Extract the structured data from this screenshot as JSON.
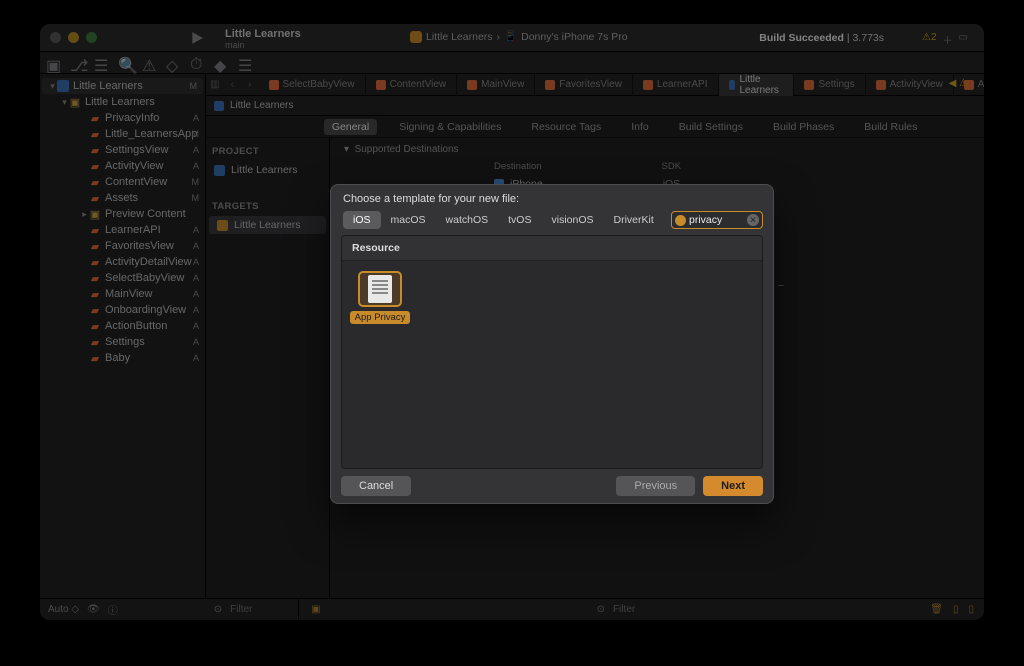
{
  "window": {
    "project_title": "Little Learners",
    "branch": "main",
    "scheme": "Little Learners",
    "scheme_sep": "›",
    "destination": "Donny's iPhone 7s Pro",
    "build_status_label": "Build Succeeded",
    "build_time": "3.773s",
    "warning_count": "2"
  },
  "navigator": {
    "root": "Little Learners",
    "root_badge": "M",
    "group": "Little Learners",
    "items": [
      {
        "name": "PrivacyInfo",
        "badge": "A"
      },
      {
        "name": "Little_LearnersApp",
        "badge": "M"
      },
      {
        "name": "SettingsView",
        "badge": "A"
      },
      {
        "name": "ActivityView",
        "badge": "A"
      },
      {
        "name": "ContentView",
        "badge": "M"
      },
      {
        "name": "Assets",
        "badge": "M"
      },
      {
        "name": "Preview Content",
        "badge": "",
        "folder": true
      },
      {
        "name": "LearnerAPI",
        "badge": "A"
      },
      {
        "name": "FavoritesView",
        "badge": "A"
      },
      {
        "name": "ActivityDetailView",
        "badge": "A"
      },
      {
        "name": "SelectBabyView",
        "badge": "A"
      },
      {
        "name": "MainView",
        "badge": "A"
      },
      {
        "name": "OnboardingView",
        "badge": "A"
      },
      {
        "name": "ActionButton",
        "badge": "A"
      },
      {
        "name": "Settings",
        "badge": "A"
      },
      {
        "name": "Baby",
        "badge": "A"
      }
    ],
    "filter_placeholder": "Filter"
  },
  "tabs": [
    {
      "label": "SelectBabyView",
      "kind": "swift"
    },
    {
      "label": "ContentView",
      "kind": "swift"
    },
    {
      "label": "MainView",
      "kind": "swift"
    },
    {
      "label": "FavoritesView",
      "kind": "swift"
    },
    {
      "label": "LearnerAPI",
      "kind": "swift"
    },
    {
      "label": "Little Learners",
      "kind": "proj",
      "active": true
    },
    {
      "label": "Settings",
      "kind": "swift"
    },
    {
      "label": "ActivityView",
      "kind": "swift"
    },
    {
      "label": "ActivityDe…",
      "kind": "swift"
    }
  ],
  "breadcrumb": "Little Learners",
  "editor_segments": [
    "General",
    "Signing & Capabilities",
    "Resource Tags",
    "Info",
    "Build Settings",
    "Build Phases",
    "Build Rules"
  ],
  "editor_active_segment": "General",
  "targets_panel": {
    "project_hdr": "PROJECT",
    "project_item": "Little Learners",
    "targets_hdr": "TARGETS",
    "target_item": "Little Learners",
    "filter_placeholder": "Filter"
  },
  "settings": {
    "section": "Supported Destinations",
    "col1": "Destination",
    "col2": "SDK",
    "dest": "iPhone",
    "sdk": "iOS"
  },
  "debugbar": {
    "auto": "Auto ◇",
    "filter_placeholder": "Filter"
  },
  "modal": {
    "title": "Choose a template for your new file:",
    "platforms": [
      "iOS",
      "macOS",
      "watchOS",
      "tvOS",
      "visionOS",
      "DriverKit"
    ],
    "active_platform": "iOS",
    "search_value": "privacy",
    "section": "Resource",
    "template_label": "App Privacy",
    "cancel": "Cancel",
    "previous": "Previous",
    "next": "Next"
  }
}
